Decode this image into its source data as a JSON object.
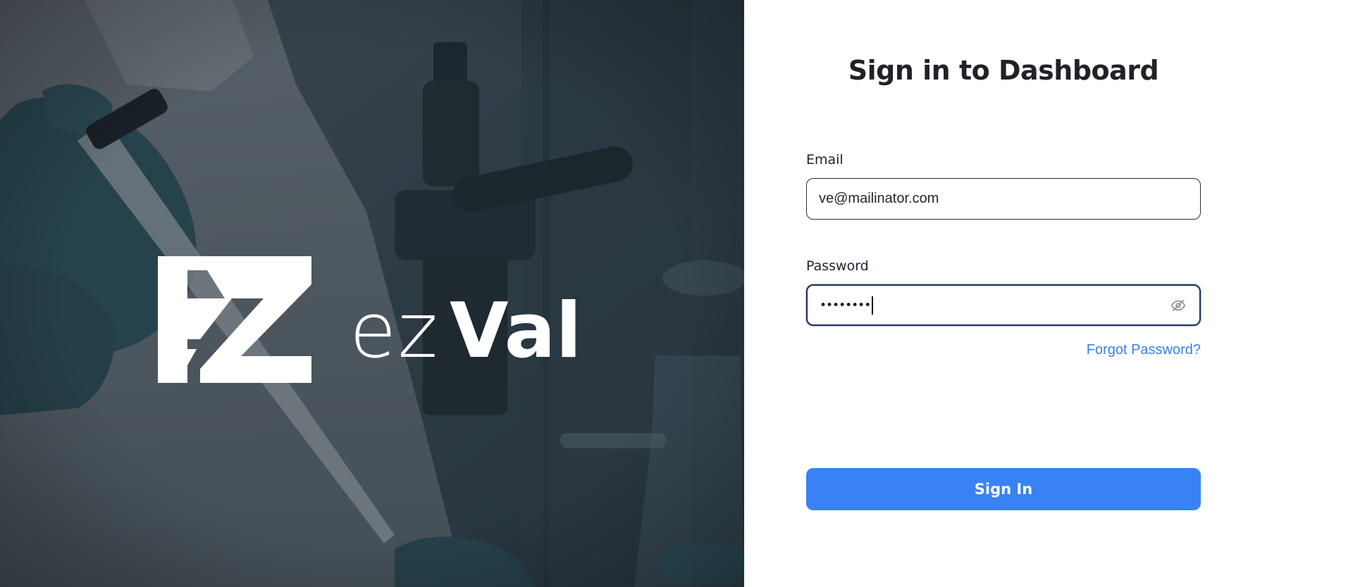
{
  "brand": {
    "name_light": "ez",
    "name_bold": "Val",
    "mark_icon": "ez-logo-mark"
  },
  "form": {
    "title": "Sign in to Dashboard",
    "email_label": "Email",
    "email_value": "ve@mailinator.com",
    "password_label": "Password",
    "password_masked": "••••••••",
    "password_toggle_icon": "eye-off-icon",
    "forgot_link": "Forgot Password?",
    "submit_label": "Sign In"
  },
  "colors": {
    "accent": "#3882f4",
    "link": "#3a7ee6",
    "title": "#1f2328",
    "hero_overlay": "#2f3b45"
  }
}
